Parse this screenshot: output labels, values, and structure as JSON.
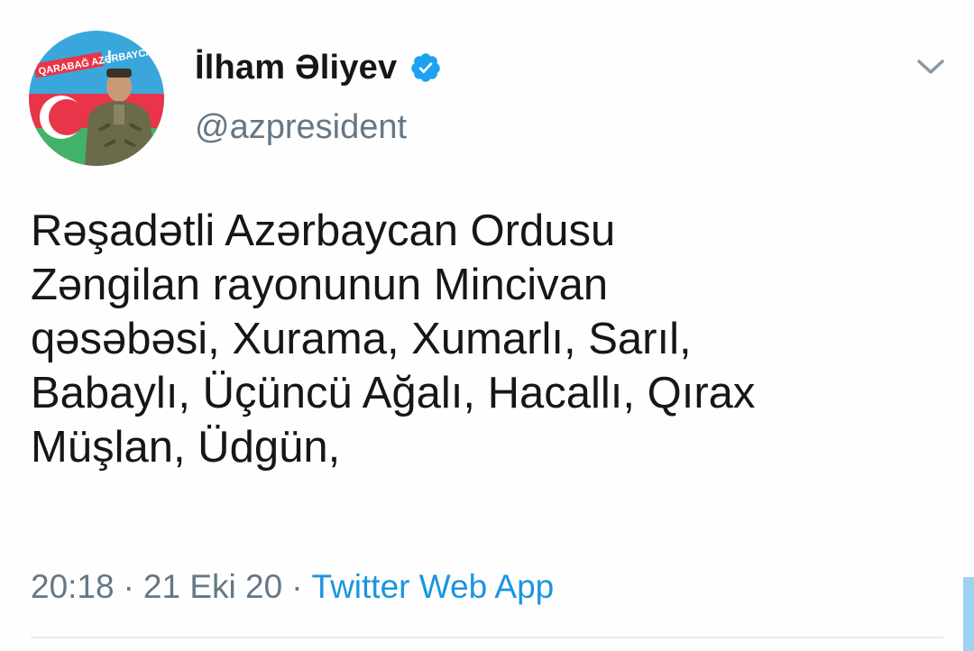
{
  "author": {
    "display_name": "İlham Əliyev",
    "handle": "@azpresident",
    "verified": true,
    "avatar_banner_text": "QARABAĞ AZƏRBAYCANDIR",
    "avatar_banner_emphasis": "!"
  },
  "tweet": {
    "text_lines": [
      "Rəşadətli Azərbaycan Ordusu",
      "Zəngilan rayonunun Mincivan",
      "qəsəbəsi, Xurama, Xumarlı, Sarıl,",
      "Babaylı, Üçüncü Ağalı, Hacallı, Qırax",
      "Müşlan, Üdgün,"
    ],
    "time": "20:18",
    "separator": "·",
    "date": "21 Eki 20",
    "source": "Twitter Web App"
  },
  "icons": {
    "verified": "verified-badge-icon",
    "menu": "chevron-down-icon"
  },
  "colors": {
    "verified_blue": "#1da1f2",
    "link_blue": "#1b95e0",
    "secondary_text": "#657786",
    "primary_text": "#14171a"
  }
}
